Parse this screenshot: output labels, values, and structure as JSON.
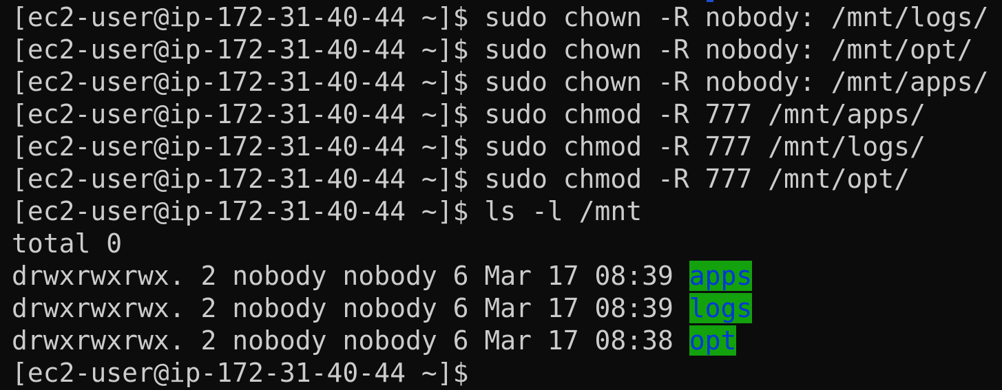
{
  "terminal": {
    "prompt": "[ec2-user@ip-172-31-40-44 ~]$",
    "commands": [
      "sudo chown -R nobody: /mnt/logs/",
      "sudo chown -R nobody: /mnt/opt/",
      "sudo chown -R nobody: /mnt/apps/",
      "sudo chmod -R 777 /mnt/apps/",
      "sudo chmod -R 777 /mnt/logs/",
      "sudo chmod -R 777 /mnt/opt/",
      "ls -l /mnt"
    ],
    "total_line": "total 0",
    "listing": [
      {
        "meta": "drwxrwxrwx. 2 nobody nobody 6 Mar 17 08:39",
        "name": "apps"
      },
      {
        "meta": "drwxrwxrwx. 2 nobody nobody 6 Mar 17 08:39",
        "name": "logs"
      },
      {
        "meta": "drwxrwxrwx. 2 nobody nobody 6 Mar 17 08:38",
        "name": "opt"
      }
    ]
  },
  "colors": {
    "background": "#0c0c0c",
    "foreground": "#cccccc",
    "dir_background": "#13a10e",
    "dir_foreground": "#0037da"
  }
}
